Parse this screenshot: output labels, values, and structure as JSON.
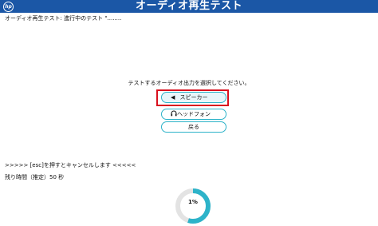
{
  "header": {
    "logo_text": "hp",
    "title": "オーディオ再生テスト"
  },
  "status": {
    "text": "オーディオ再生テスト: 進行中のテスト \"........"
  },
  "prompt": {
    "text": "テストするオーディオ出力を選択してください。"
  },
  "options": [
    {
      "label": "スピーカー",
      "icon": "speaker-icon",
      "selected": true
    },
    {
      "label": "ヘッドフォン",
      "icon": "headphones-icon",
      "selected": false
    }
  ],
  "back": {
    "label": "戻る"
  },
  "cancel_hint": {
    "text": ">>>>> [esc]を押すとキャンセルします <<<<<"
  },
  "remaining": {
    "text": "残り時間（推定）50 秒"
  },
  "progress": {
    "percent": 1,
    "label": "1%"
  },
  "colors": {
    "title_bar": "#1b57a6",
    "accent": "#2db3c9",
    "selection_frame": "#d9101e",
    "progress_track": "#e3e3e3",
    "progress_fill": "#2db3c9"
  }
}
